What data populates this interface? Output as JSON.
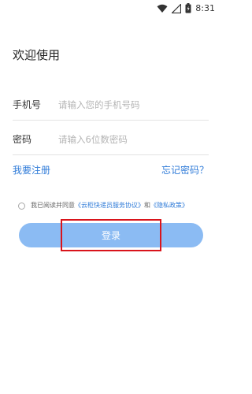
{
  "status_bar": {
    "time": "8:31",
    "icons": [
      "wifi-icon",
      "signal-icon",
      "battery-icon"
    ]
  },
  "title": "欢迎使用",
  "form": {
    "phone_label": "手机号",
    "phone_placeholder": "请输入您的手机号码",
    "phone_value": "",
    "code_label": "密码",
    "code_placeholder": "请输入6位数密码",
    "code_value": ""
  },
  "links": {
    "register": "我要注册",
    "forgot": "忘记密码？"
  },
  "agreement": {
    "prefix": "我已阅读并同意",
    "service": "《云柜快递员服务协议》",
    "and": "和",
    "privacy": "《隐私政策》"
  },
  "login_button": "登录",
  "colors": {
    "link": "#2f7bd8",
    "button": "#8bbbf3",
    "highlight": "#d9141b"
  }
}
